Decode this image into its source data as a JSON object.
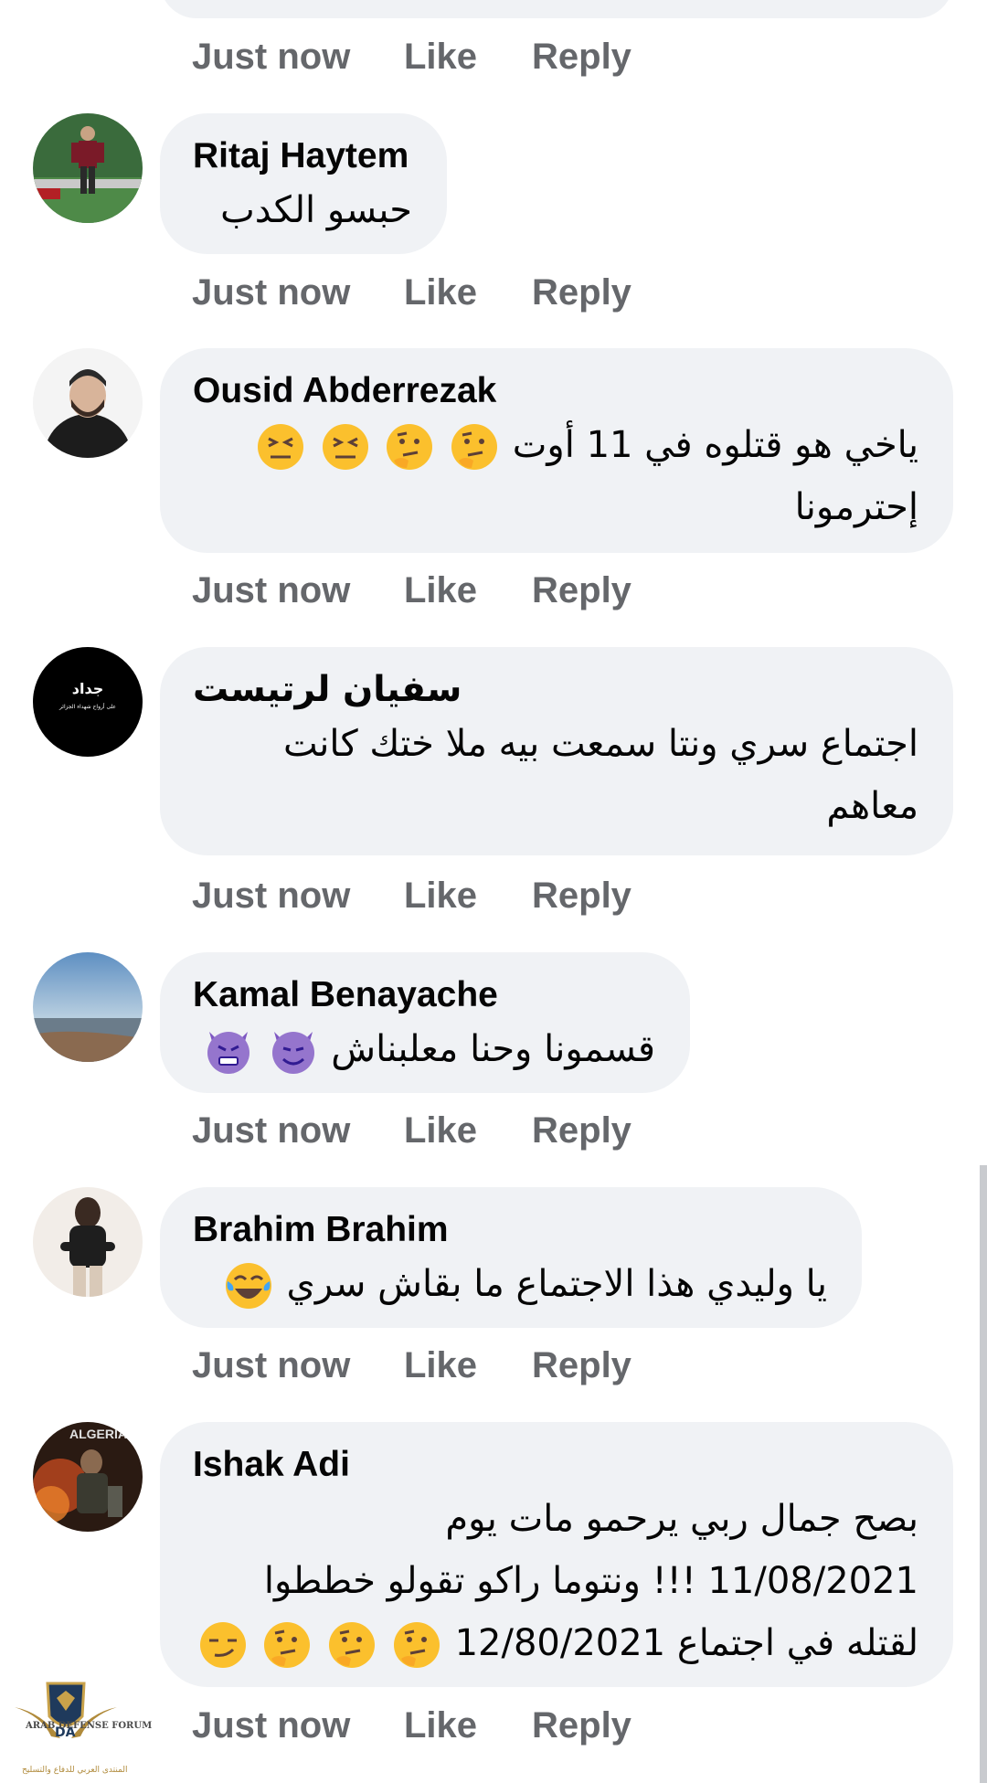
{
  "colors": {
    "bubble": "#f0f2f5",
    "action_text": "#65676b",
    "name_text": "#050505"
  },
  "actions": {
    "time": "Just now",
    "like": "Like",
    "reply": "Reply"
  },
  "comments": [
    {
      "name": "Ritaj Haytem",
      "text": [
        "حبسو الكدب"
      ],
      "emoji": []
    },
    {
      "name": "Ousid Abderrezak",
      "text": [
        "ياخي هو قتلوه في 11 أوت",
        "إحترمونا"
      ],
      "emoji": [
        "thinking-face",
        "thinking-face",
        "confounded-face",
        "confounded-face"
      ]
    },
    {
      "name": "سفيان لرتيست",
      "text": [
        "اجتماع سري ونتا سمعت بيه ملا ختك كانت",
        "معاهم"
      ],
      "emoji": [],
      "avatar_text": [
        "جداد",
        "على أرواح شهداء الجزائر"
      ]
    },
    {
      "name": "Kamal Benayache",
      "text": [
        "قسمونا وحنا معلبناش"
      ],
      "emoji": [
        "smiling-imp",
        "angry-imp"
      ]
    },
    {
      "name": "Brahim Brahim",
      "text": [
        "يا وليدي هذا الاجتماع ما بقاش سري"
      ],
      "emoji": [
        "tears-of-joy"
      ]
    },
    {
      "name": "Ishak Adi",
      "text": [
        "بصح جمال ربي يرحمو مات يوم",
        "11/08/2021 !!! ونتوما راكو تقولو خططوا",
        "لقتله في اجتماع 12/80/2021"
      ],
      "emoji": [
        "thinking-face",
        "thinking-face",
        "thinking-face",
        "smirking-face"
      ],
      "avatar_text": "ALGERIA"
    }
  ],
  "watermark": {
    "line1": "ARAB DEFENSE FORUM",
    "line2": "المنتدى العربي للدفاع والتسليح",
    "logo_letters": "DA"
  }
}
